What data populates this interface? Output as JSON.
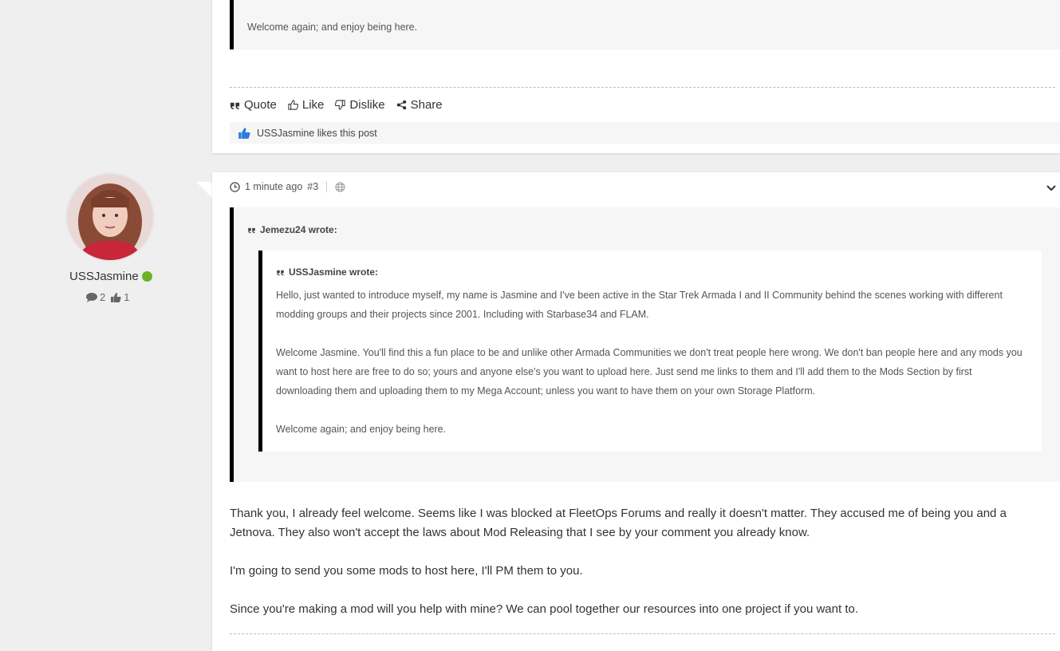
{
  "prev_post": {
    "quote_text": "Welcome again; and enjoy being here.",
    "actions": {
      "quote": "Quote",
      "like": "Like",
      "dislike": "Dislike",
      "share": "Share"
    },
    "likes_text": "USSJasmine likes this post"
  },
  "author": {
    "username": "USSJasmine",
    "status": "online",
    "posts_count": "2",
    "likes_count": "1"
  },
  "post": {
    "time": "1 minute ago",
    "number": "#3",
    "outer_quote": {
      "author_line": "Jemezu24 wrote:"
    },
    "inner_quote": {
      "author_line": "USSJasmine wrote:",
      "paragraphs": [
        "Hello, just wanted to introduce myself, my name is Jasmine and I've been active in the Star Trek Armada I and II Community behind the scenes working with different modding groups and their projects since 2001. Including with Starbase34 and FLAM.",
        "Welcome Jasmine. You'll find this a fun place to be and unlike other Armada Communities we don't treat people here wrong. We don't ban people here and any mods you want to host here are free to do so; yours and anyone else's you want to upload here. Just send me links to them and I'll add them to the Mods Section by first downloading them and uploading them to my Mega Account; unless you want to have them on your own Storage Platform.",
        "Welcome again; and enjoy being here."
      ]
    },
    "body": [
      "Thank you, I already feel welcome. Seems like I was blocked at FleetOps Forums and really it doesn't matter. They accused me of being you and a Jetnova. They also won't accept the laws about Mod Releasing that I see by your comment you already know.",
      "I'm going to send you some mods to host here, I'll PM them to you.",
      "Since you're making a mod will you help with mine? We can pool together our resources into one project if you want to."
    ]
  },
  "colors": {
    "online": "#6ab324",
    "like_blue": "#2d7de0",
    "quote_border": "#000000"
  }
}
